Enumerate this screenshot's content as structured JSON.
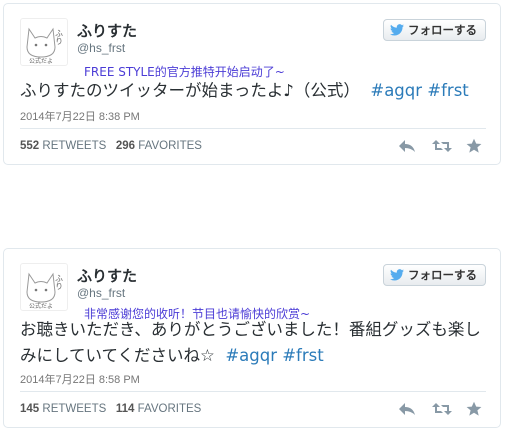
{
  "tweets": [
    {
      "display_name": "ふりすた",
      "handle": "@hs_frst",
      "follow_label": "フォローする",
      "annotation": "FREE STYLE的官方推特开始启动了~",
      "text_plain": "ふりすたのツイッターが始まったよ♪（公式）",
      "hashtags": [
        "#agqr",
        "#frst"
      ],
      "timestamp": "2014年7月22日  8:38 PM",
      "retweets_count": "552",
      "retweets_label": "RETWEETS",
      "favorites_count": "296",
      "favorites_label": "FAVORITES"
    },
    {
      "display_name": "ふりすた",
      "handle": "@hs_frst",
      "follow_label": "フォローする",
      "annotation": "非常感谢您的收听！节目也请愉快的欣赏~",
      "text_line1": "お聴きいただき、ありがとうございました！番組グッズも楽し",
      "text_line2": "みにしていてくださいね☆",
      "hashtags": [
        "#agqr",
        "#frst"
      ],
      "timestamp": "2014年7月22日  8:58 PM",
      "retweets_count": "145",
      "retweets_label": "RETWEETS",
      "favorites_count": "114",
      "favorites_label": "FAVORITES"
    }
  ],
  "avatar_text": [
    "ふりすた",
    "公式だよ"
  ],
  "icons": [
    "twitter-bird-icon",
    "reply-icon",
    "retweet-icon",
    "favorite-star-icon"
  ],
  "colors": {
    "hashtag": "#2b7bb9",
    "annotation": "#4b3cd6",
    "bird": "#55acee"
  }
}
